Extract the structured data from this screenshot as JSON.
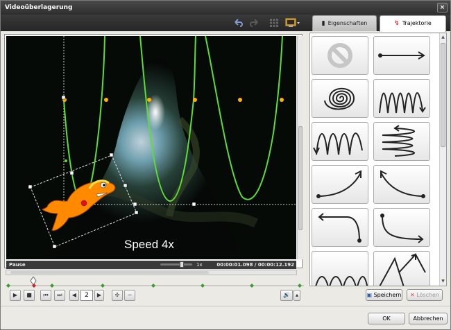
{
  "window": {
    "title": "Videoüberlagerung",
    "close_glyph": "×"
  },
  "toolbar": {
    "icons": [
      "undo-icon",
      "redo-icon",
      "grid-icon",
      "monitor-icon"
    ]
  },
  "tabs": [
    {
      "label": "Eigenschaften",
      "active": false
    },
    {
      "label": "Trajektorie",
      "active": true
    }
  ],
  "video": {
    "overlay_text": "Speed 4x"
  },
  "status": {
    "state": "Pause",
    "speed": "1x",
    "timecode": "00:00:01.098 / 00:00:12.192"
  },
  "playback": {
    "speed_value": "2"
  },
  "trajectories": [
    {
      "name": "no-trajectory-icon"
    },
    {
      "name": "straight-line-icon"
    },
    {
      "name": "spiral-icon"
    },
    {
      "name": "sine-wave-vertical-icon"
    },
    {
      "name": "sine-wave-down-icon"
    },
    {
      "name": "zigzag-horizontal-icon"
    },
    {
      "name": "curve-up-right-icon"
    },
    {
      "name": "curve-up-left-icon"
    },
    {
      "name": "curve-left-down-icon"
    },
    {
      "name": "curve-down-right-icon"
    },
    {
      "name": "wave-partial-icon"
    },
    {
      "name": "loop-partial-icon"
    }
  ],
  "buttons": {
    "save": "Speichern",
    "delete": "Löschen",
    "ok": "OK",
    "cancel": "Abbrechen"
  },
  "colors": {
    "trajectory": "#5fdc36",
    "keypoint": "#ffb000",
    "title_bar": "#353535"
  }
}
